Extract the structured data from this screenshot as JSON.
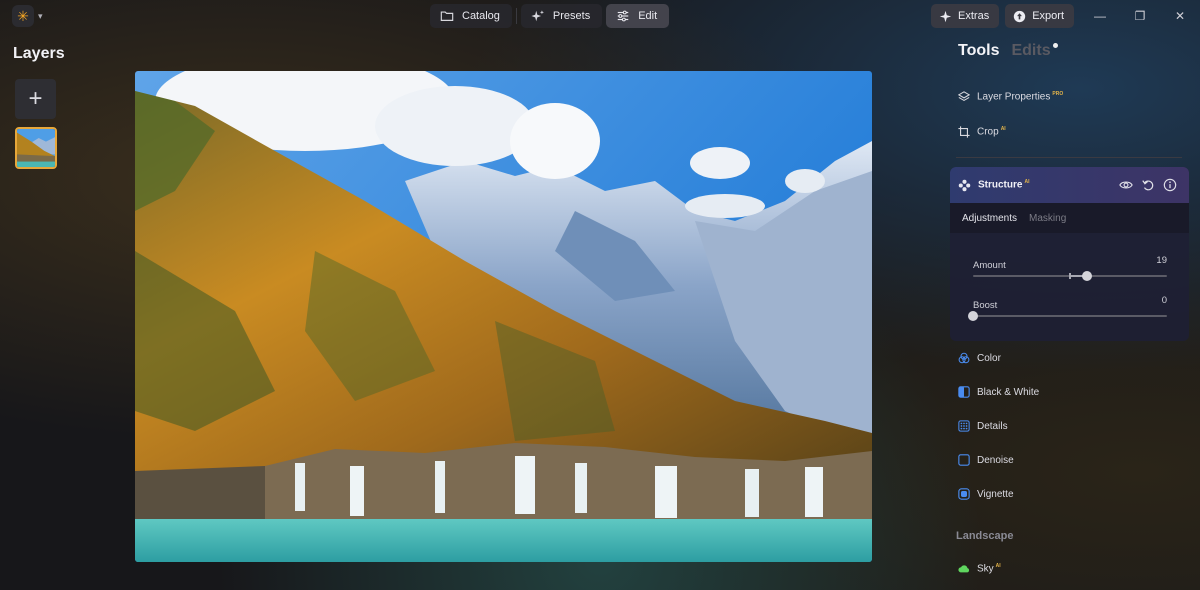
{
  "topbar": {
    "app_menu_icon": "sun-logo-icon",
    "nav": [
      {
        "label": "Catalog",
        "icon": "folder-icon",
        "active": false
      },
      {
        "label": "Presets",
        "icon": "sparkles-icon",
        "active": false
      },
      {
        "label": "Edit",
        "icon": "sliders-icon",
        "active": true
      }
    ],
    "extras_label": "Extras",
    "export_label": "Export",
    "window_controls": {
      "minimize": "—",
      "restore": "❐",
      "close": "✕"
    }
  },
  "layers": {
    "title": "Layers",
    "add_label": "+"
  },
  "right_panel": {
    "tabs": [
      {
        "label": "Tools",
        "active": true
      },
      {
        "label": "Edits",
        "active": false
      }
    ],
    "tools_top": [
      {
        "label": "Layer Properties",
        "badge": "PRO",
        "icon": "layers-icon"
      },
      {
        "label": "Crop",
        "badge": "AI",
        "icon": "crop-icon"
      }
    ],
    "structure": {
      "title": "Structure",
      "badge": "AI",
      "subtabs": [
        {
          "label": "Adjustments",
          "active": true
        },
        {
          "label": "Masking",
          "active": false
        }
      ],
      "sliders": [
        {
          "label": "Amount",
          "value": "19",
          "fraction": 0.59,
          "center_tick": 0.5
        },
        {
          "label": "Boost",
          "value": "0",
          "fraction": 0.0,
          "center_tick": null
        }
      ]
    },
    "tools_bottom": [
      {
        "label": "Color",
        "icon": "color-circles-icon",
        "color": "#4a8cf0"
      },
      {
        "label": "Black & White",
        "icon": "half-square-icon",
        "color": "#4a8cf0"
      },
      {
        "label": "Details",
        "icon": "grid-dots-icon",
        "color": "#4a8cf0"
      },
      {
        "label": "Denoise",
        "icon": "square-icon",
        "color": "#4a8cf0"
      },
      {
        "label": "Vignette",
        "icon": "vignette-icon",
        "color": "#4a8cf0"
      }
    ],
    "landscape_section": {
      "title": "Landscape",
      "items": [
        {
          "label": "Sky",
          "badge": "AI",
          "icon": "cloud-icon",
          "color": "#5fd65f"
        }
      ]
    }
  },
  "colors": {
    "accent_gold": "#e7a73a",
    "structure_header": "#2f3b6f",
    "tool_icon_blue": "#4a8cf0"
  }
}
